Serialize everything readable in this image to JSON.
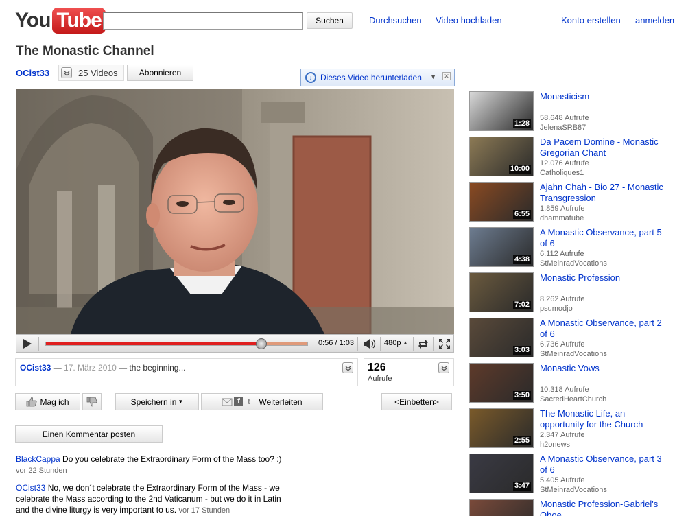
{
  "header": {
    "logo_you": "You",
    "logo_tube": "Tube",
    "search_placeholder": "",
    "search_button": "Suchen",
    "nav": {
      "browse": "Durchsuchen",
      "upload": "Video hochladen",
      "create_account": "Konto erstellen",
      "sign_in": "anmelden"
    }
  },
  "channel": {
    "title": "The Monastic Channel",
    "user": "OCist33",
    "videos_count": "25 Videos",
    "subscribe": "Abonnieren",
    "download_label": "Dieses Video herunterladen"
  },
  "player": {
    "progress_fraction": 0.82,
    "buffer_fraction": 1.0,
    "time": "0:56 / 1:03",
    "quality": "480p"
  },
  "info": {
    "user": "OCist33",
    "sep1": " — ",
    "date": "17. März 2010",
    "desc": " — the beginning...",
    "views_count": "126",
    "views_label": "Aufrufe"
  },
  "actions": {
    "like": "Mag ich",
    "save": "Speichern in",
    "share": "Weiterleiten",
    "embed": "<Einbetten>",
    "post_comment": "Einen Kommentar posten"
  },
  "comments": [
    {
      "author": "BlackCappa",
      "text": " Do you celebrate the Extraordinary Form of the Mass too? :)",
      "ago": "vor 22 Stunden"
    },
    {
      "author": "OCist33",
      "text": "  No, we don´t celebrate the Extraordinary Form of the Mass - we celebrate the Mass according to the 2nd Vaticanum - but we do it in Latin and the divine liturgy is very important to us.",
      "ago": "vor 17 Stunden"
    }
  ],
  "sidebar": [
    {
      "title": "Monasticism",
      "views": "58.648 Aufrufe",
      "author": "JelenaSRB87",
      "duration": "1:28",
      "thumb_color": "#d8d8d8"
    },
    {
      "title": "Da Pacem Domine - Monastic Gregorian Chant",
      "views": "12.076 Aufrufe",
      "author": "Catholiques1",
      "duration": "10:00",
      "thumb_color": "#8c7a55"
    },
    {
      "title": "Ajahn Chah - Bio 27 - Monastic Transgression",
      "views": "1.859 Aufrufe",
      "author": "dhammatube",
      "duration": "6:55",
      "thumb_color": "#8a4a22"
    },
    {
      "title": "A Monastic Observance, part 5 of 6",
      "views": "6.112 Aufrufe",
      "author": "StMeinradVocations",
      "duration": "4:38",
      "thumb_color": "#6d7c90"
    },
    {
      "title": "Monastic Profession",
      "views": "8.262 Aufrufe",
      "author": "psumodjo",
      "duration": "7:02",
      "thumb_color": "#6b5a3e"
    },
    {
      "title": "A Monastic Observance, part 2 of 6",
      "views": "6.736 Aufrufe",
      "author": "StMeinradVocations",
      "duration": "3:03",
      "thumb_color": "#5a4a3a"
    },
    {
      "title": "Monastic Vows",
      "views": "10.318 Aufrufe",
      "author": "SacredHeartChurch",
      "duration": "3:50",
      "thumb_color": "#5e3a2a"
    },
    {
      "title": "The Monastic Life, an opportunity for the Church",
      "views": "2.347 Aufrufe",
      "author": "h2onews",
      "duration": "2:55",
      "thumb_color": "#7a5a2a"
    },
    {
      "title": "A Monastic Observance, part 3 of 6",
      "views": "5.405 Aufrufe",
      "author": "StMeinradVocations",
      "duration": "3:47",
      "thumb_color": "#3a3a44"
    },
    {
      "title": "Monastic Profession-Gabriel's Oboe",
      "views": "",
      "author": "",
      "duration": "",
      "thumb_color": "#7a4a3a"
    }
  ]
}
